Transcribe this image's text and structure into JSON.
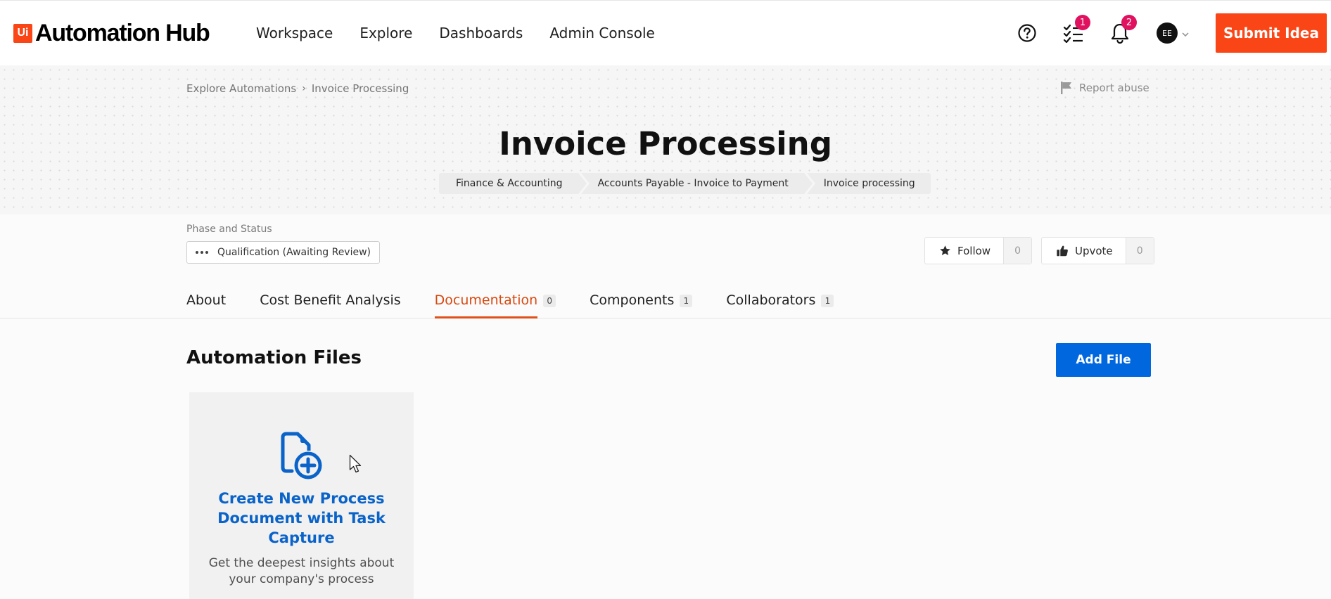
{
  "brand": {
    "logo_text": "Ui",
    "name": "Automation Hub",
    "accent": "#fa4616"
  },
  "nav": {
    "links": [
      "Workspace",
      "Explore",
      "Dashboards",
      "Admin Console"
    ]
  },
  "header_icons": {
    "help": "question-circle-icon",
    "tasks": {
      "icon": "task-list-icon",
      "badge": "1"
    },
    "notifications": {
      "icon": "bell-icon",
      "badge": "2"
    },
    "user": {
      "initials": "EE",
      "icon": "chevron-down-icon"
    }
  },
  "submit_idea": "Submit Idea",
  "breadcrumb": {
    "parent": "Explore Automations",
    "current": "Invoice Processing"
  },
  "report_abuse": "Report abuse",
  "title": "Invoice Processing",
  "category_path": [
    "Finance & Accounting",
    "Accounts Payable - Invoice to Payment",
    "Invoice processing"
  ],
  "phase": {
    "label": "Phase and Status",
    "value": "Qualification (Awaiting Review)"
  },
  "actions": {
    "follow": {
      "label": "Follow",
      "count": "0"
    },
    "upvote": {
      "label": "Upvote",
      "count": "0"
    }
  },
  "tabs": [
    {
      "label": "About",
      "count": null
    },
    {
      "label": "Cost Benefit Analysis",
      "count": null
    },
    {
      "label": "Documentation",
      "count": "0",
      "active": true
    },
    {
      "label": "Components",
      "count": "1"
    },
    {
      "label": "Collaborators",
      "count": "1"
    }
  ],
  "files": {
    "title": "Automation Files",
    "add_label": "Add File",
    "card": {
      "icon": "document-add-icon",
      "title": "Create New Process Document with Task Capture",
      "description": "Get the deepest insights about your company's process"
    }
  },
  "colors": {
    "primary_blue": "#0067df",
    "active_tab": "#d9480f",
    "badge": "#e0115f"
  }
}
